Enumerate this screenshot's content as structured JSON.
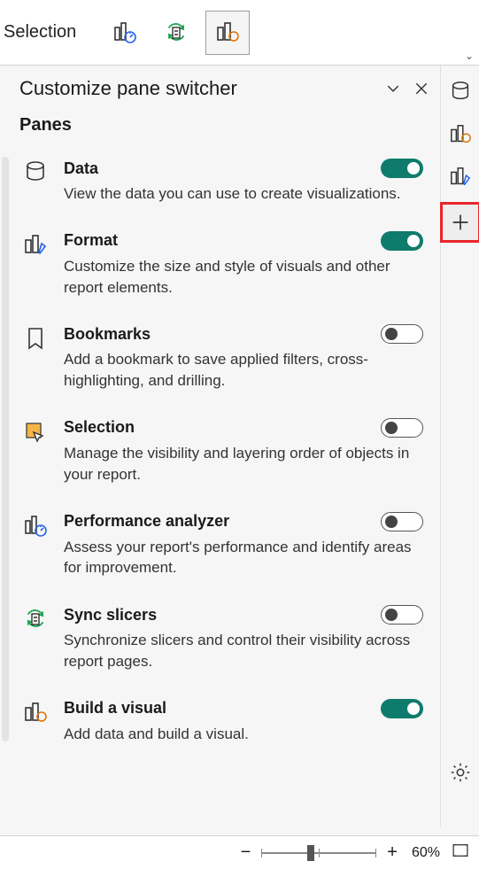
{
  "top_bar": {
    "title": "Selection"
  },
  "chevron": "⌄",
  "panel": {
    "title": "Customize pane switcher",
    "subheader": "Panes"
  },
  "panes": [
    {
      "title": "Data",
      "desc": "View the data you can use to create visualizations.",
      "on": true
    },
    {
      "title": "Format",
      "desc": "Customize the size and style of visuals and other report elements.",
      "on": true
    },
    {
      "title": "Bookmarks",
      "desc": "Add a bookmark to save applied filters, cross-highlighting, and drilling.",
      "on": false
    },
    {
      "title": "Selection",
      "desc": "Manage the visibility and layering order of objects in your report.",
      "on": false
    },
    {
      "title": "Performance analyzer",
      "desc": "Assess your report's performance and identify areas for improvement.",
      "on": false
    },
    {
      "title": "Sync slicers",
      "desc": "Synchronize slicers and control their visibility across report pages.",
      "on": false
    },
    {
      "title": "Build a visual",
      "desc": "Add data and build a visual.",
      "on": true
    }
  ],
  "zoom": {
    "minus": "−",
    "plus": "+",
    "label": "60%"
  }
}
